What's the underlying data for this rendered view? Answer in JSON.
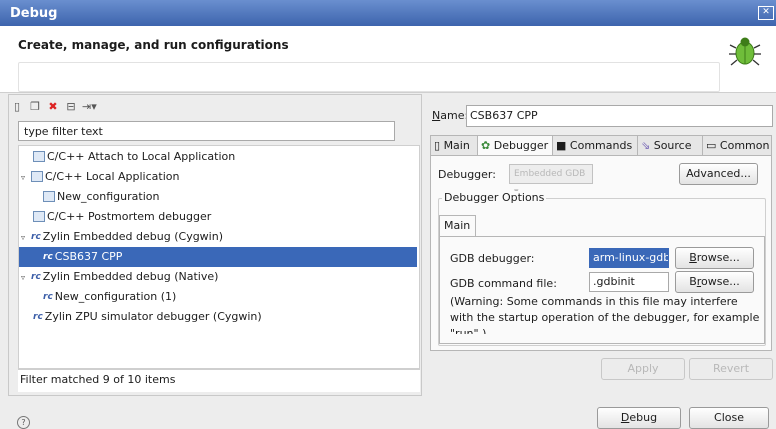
{
  "window": {
    "title": "Debug"
  },
  "header": {
    "title": "Create, manage, and run configurations",
    "message": ""
  },
  "left": {
    "filter_placeholder": "type filter text",
    "tree": [
      {
        "label": "C/C++ Attach to Local Application",
        "icon": "c-config-icon",
        "expanded": null,
        "level": 0
      },
      {
        "label": "C/C++ Local Application",
        "icon": "c-config-icon",
        "expanded": true,
        "level": 0
      },
      {
        "label": "New_configuration",
        "icon": "c-config-icon",
        "expanded": null,
        "level": 1
      },
      {
        "label": "C/C++ Postmortem debugger",
        "icon": "c-config-icon",
        "expanded": null,
        "level": 0
      },
      {
        "label": "Zylin Embedded debug (Cygwin)",
        "icon": "zylin-icon",
        "expanded": true,
        "level": 0
      },
      {
        "label": "CSB637  CPP",
        "icon": "zylin-icon",
        "expanded": null,
        "level": 1,
        "selected": true
      },
      {
        "label": "Zylin Embedded debug (Native)",
        "icon": "zylin-icon",
        "expanded": true,
        "level": 0
      },
      {
        "label": "New_configuration (1)",
        "icon": "zylin-icon",
        "expanded": null,
        "level": 1
      },
      {
        "label": "Zylin ZPU simulator debugger (Cygwin)",
        "icon": "zylin-icon",
        "expanded": null,
        "level": 0
      }
    ],
    "status": "Filter matched 9 of 10 items"
  },
  "right": {
    "name_label": "Name:",
    "name_value": "CSB637  CPP",
    "tabs": [
      "Main",
      "Debugger",
      "Commands",
      "Source",
      "Common"
    ],
    "active_tab": "Debugger",
    "debugger_label": "Debugger:",
    "debugger_value": "Embedded GDB",
    "advanced_button": "Advanced...",
    "options_label": "Debugger Options",
    "inner_tab": "Main",
    "gdb_debugger_label": "GDB debugger:",
    "gdb_debugger_value": "arm-linux-gdb",
    "gdb_cmd_label": "GDB command file:",
    "gdb_cmd_value": ".gdbinit",
    "browse1": "Browse...",
    "browse2": "Browse...",
    "warning": "(Warning: Some commands in this file may interfere with the startup operation of the debugger, for example \"run\".)",
    "apply": "Apply",
    "revert": "Revert"
  },
  "buttons": {
    "debug": "Debug",
    "close": "Close"
  },
  "colors": {
    "selection": "#3a68b8",
    "titlebar": "#4f77bf"
  }
}
